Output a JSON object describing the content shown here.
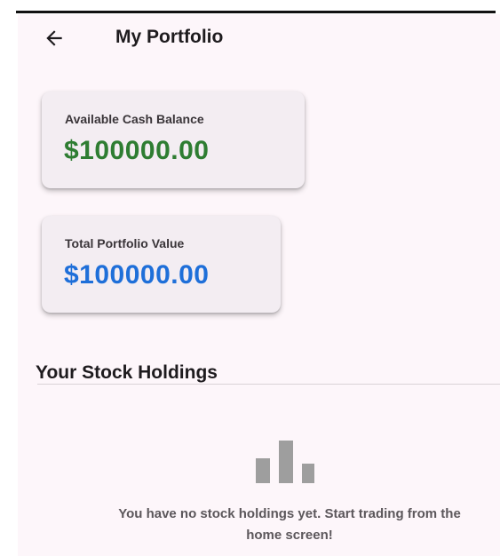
{
  "app_bar": {
    "back_icon": "arrow-left-icon",
    "title": "My Portfolio"
  },
  "cash_card": {
    "label": "Available Cash Balance",
    "value": "$100000.00",
    "value_color": "#2e7d32"
  },
  "portfolio_card": {
    "label": "Total Portfolio Value",
    "value": "$100000.00",
    "value_color": "#1e6fd9"
  },
  "holdings": {
    "title": "Your Stock Holdings",
    "empty_icon": "bar-chart-icon",
    "empty_message": "You have no stock holdings yet. Start trading from the home screen!"
  },
  "colors": {
    "background": "#fdf6fa",
    "card_background": "#f3edf2",
    "text_primary": "#1e1b1e",
    "text_muted": "#5c575b",
    "icon_gray": "#9e9e9e"
  }
}
